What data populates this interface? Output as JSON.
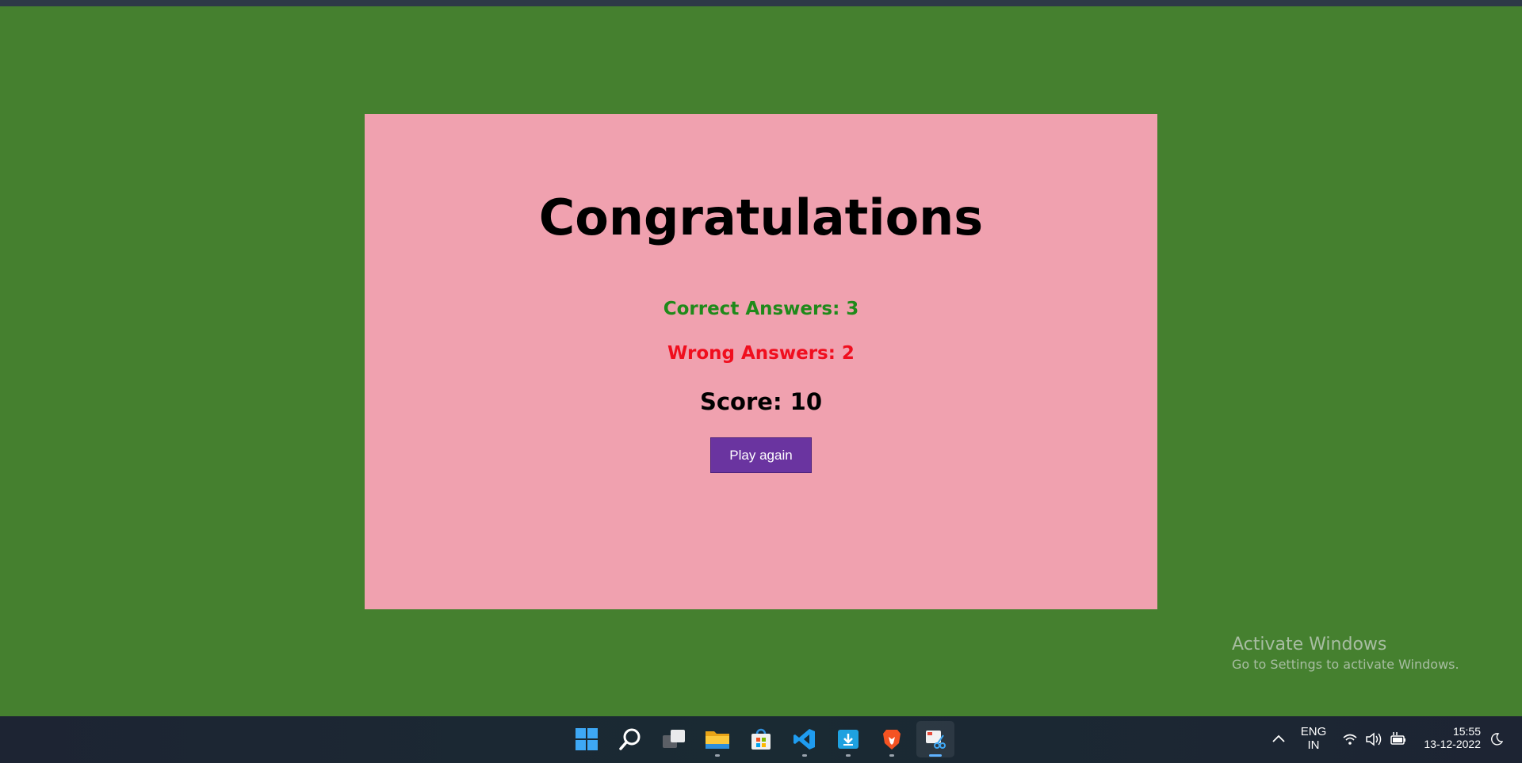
{
  "result": {
    "title": "Congratulations",
    "correct_text": "Correct Answers: 3",
    "wrong_text": "Wrong Answers: 2",
    "score_text": "Score: 10",
    "play_again_label": "Play again"
  },
  "watermark": {
    "title": "Activate Windows",
    "subtitle": "Go to Settings to activate Windows."
  },
  "taskbar": {
    "apps": [
      "start-icon",
      "search-icon",
      "task-view-icon",
      "file-explorer-icon",
      "microsoft-store-icon",
      "vscode-icon",
      "installer-icon",
      "brave-browser-icon",
      "snipping-tool-icon"
    ],
    "language_line1": "ENG",
    "language_line2": "IN",
    "time": "15:55",
    "date": "13-12-2022"
  },
  "colors": {
    "background": "#45802f",
    "card": "#f0a1af",
    "correct": "#1f8a1a",
    "wrong": "#f00e1e",
    "button": "#6a34a0"
  }
}
